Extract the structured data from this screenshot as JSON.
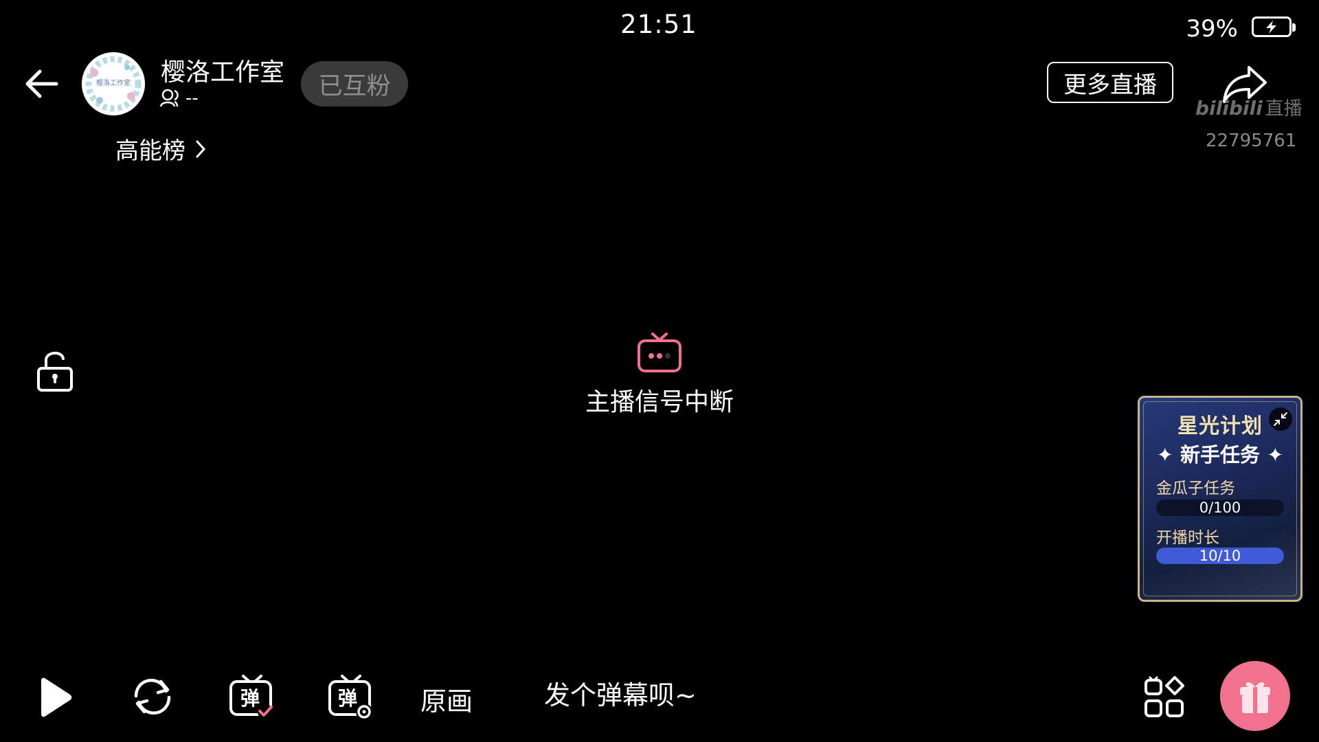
{
  "status_bar": {
    "time": "21:51",
    "battery": "39%"
  },
  "header": {
    "room_name": "樱洛工作室",
    "fans": "--",
    "follow_label": "已互粉",
    "rank_label": "高能榜",
    "more_live_label": "更多直播",
    "watermark_logo": "bilibili",
    "watermark_live": "直播",
    "room_id": "22795761",
    "avatar_text": "樱洛工作室"
  },
  "player": {
    "status_text": "主播信号中断"
  },
  "starlight": {
    "title": "星光计划",
    "subtitle": "新手任务",
    "tasks": [
      {
        "label": "金瓜子任务",
        "value": "0/100",
        "progress": 0
      },
      {
        "label": "开播时长",
        "value": "10/10",
        "progress": 1
      }
    ]
  },
  "bottom": {
    "quality_label": "原画",
    "danmaku_placeholder": "发个弹幕呗~",
    "danmaku_glyph": "弹"
  },
  "colors": {
    "accent_pink": "#f2718e",
    "progress_blue": "#3f5bd8",
    "panel_gold": "#c8b68a"
  }
}
